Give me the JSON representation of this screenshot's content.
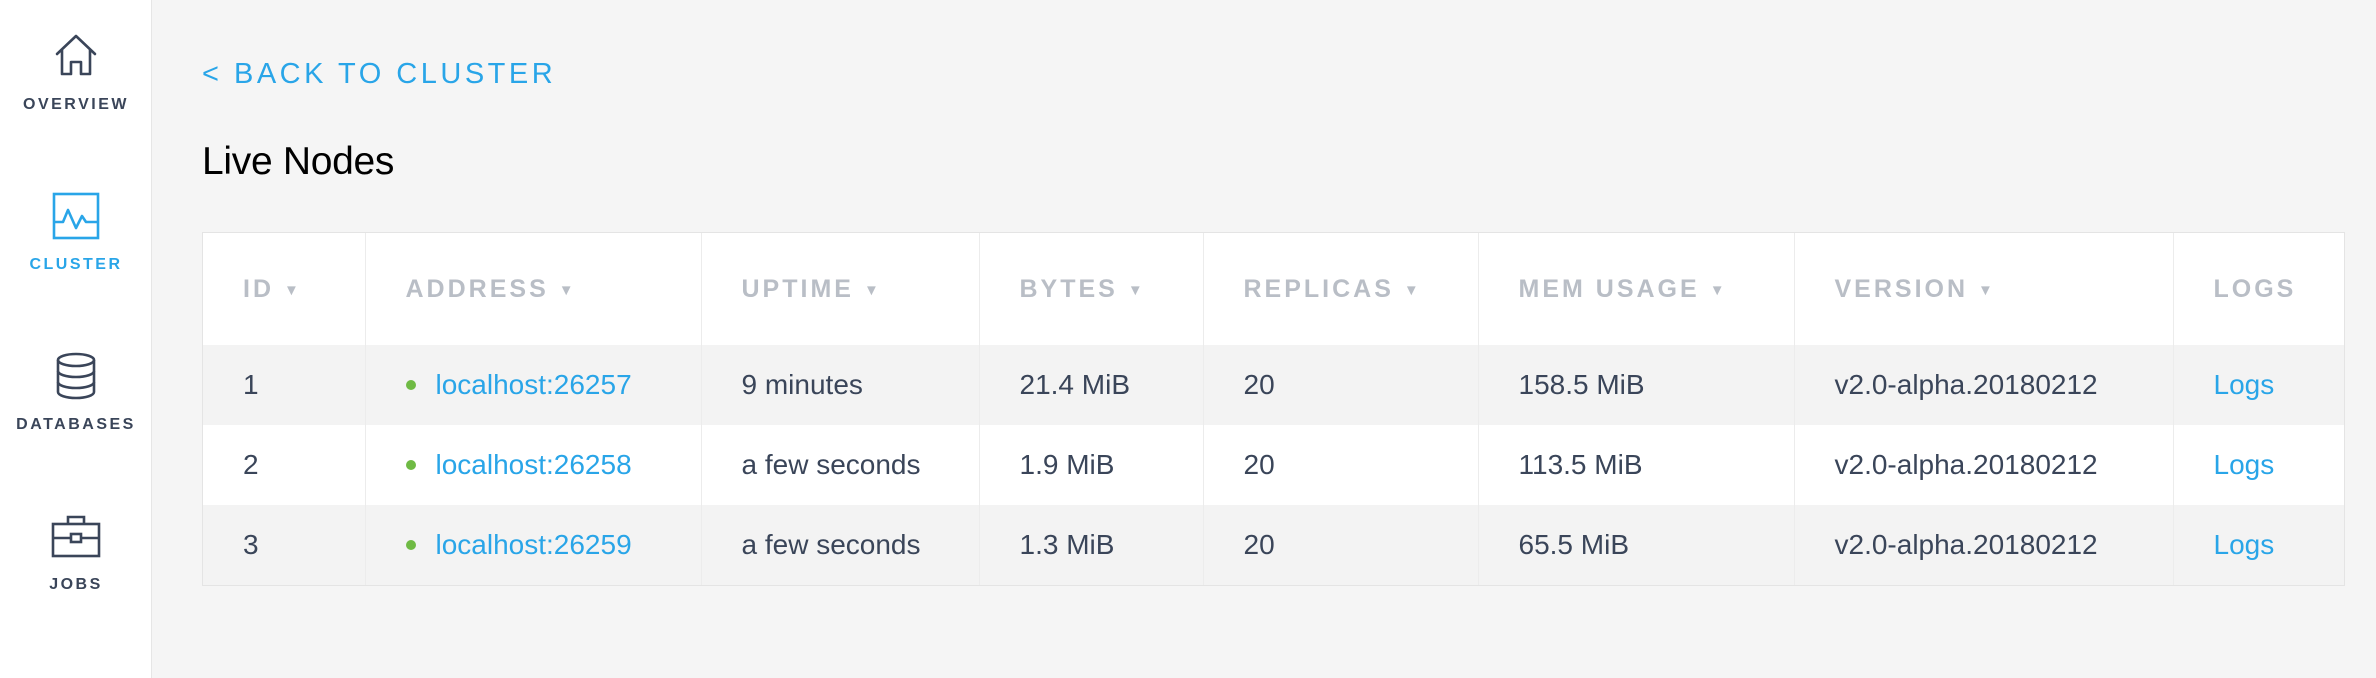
{
  "sidebar": {
    "items": [
      {
        "label": "OVERVIEW",
        "icon": "home-icon",
        "active": false
      },
      {
        "label": "CLUSTER",
        "icon": "activity-graph-icon",
        "active": true
      },
      {
        "label": "DATABASES",
        "icon": "database-icon",
        "active": false
      },
      {
        "label": "JOBS",
        "icon": "briefcase-icon",
        "active": false
      }
    ]
  },
  "main": {
    "back_link": "< BACK TO CLUSTER",
    "title": "Live Nodes"
  },
  "table": {
    "columns": [
      {
        "label": "ID",
        "sortable": true
      },
      {
        "label": "ADDRESS",
        "sortable": true
      },
      {
        "label": "UPTIME",
        "sortable": true
      },
      {
        "label": "BYTES",
        "sortable": true
      },
      {
        "label": "REPLICAS",
        "sortable": true
      },
      {
        "label": "MEM USAGE",
        "sortable": true
      },
      {
        "label": "VERSION",
        "sortable": true
      },
      {
        "label": "LOGS",
        "sortable": false
      }
    ],
    "sort_arrow": "▼",
    "rows": [
      {
        "id": "1",
        "address": "localhost:26257",
        "uptime": "9 minutes",
        "bytes": "21.4 MiB",
        "replicas": "20",
        "mem_usage": "158.5 MiB",
        "version": "v2.0-alpha.20180212",
        "logs": "Logs"
      },
      {
        "id": "2",
        "address": "localhost:26258",
        "uptime": "a few seconds",
        "bytes": "1.9 MiB",
        "replicas": "20",
        "mem_usage": "113.5 MiB",
        "version": "v2.0-alpha.20180212",
        "logs": "Logs"
      },
      {
        "id": "3",
        "address": "localhost:26259",
        "uptime": "a few seconds",
        "bytes": "1.3 MiB",
        "replicas": "20",
        "mem_usage": "65.5 MiB",
        "version": "v2.0-alpha.20180212",
        "logs": "Logs"
      }
    ]
  },
  "colors": {
    "accent": "#29a5e8",
    "status_live": "#6fba44",
    "text": "#3a4559",
    "header_text": "#b9bec6"
  }
}
